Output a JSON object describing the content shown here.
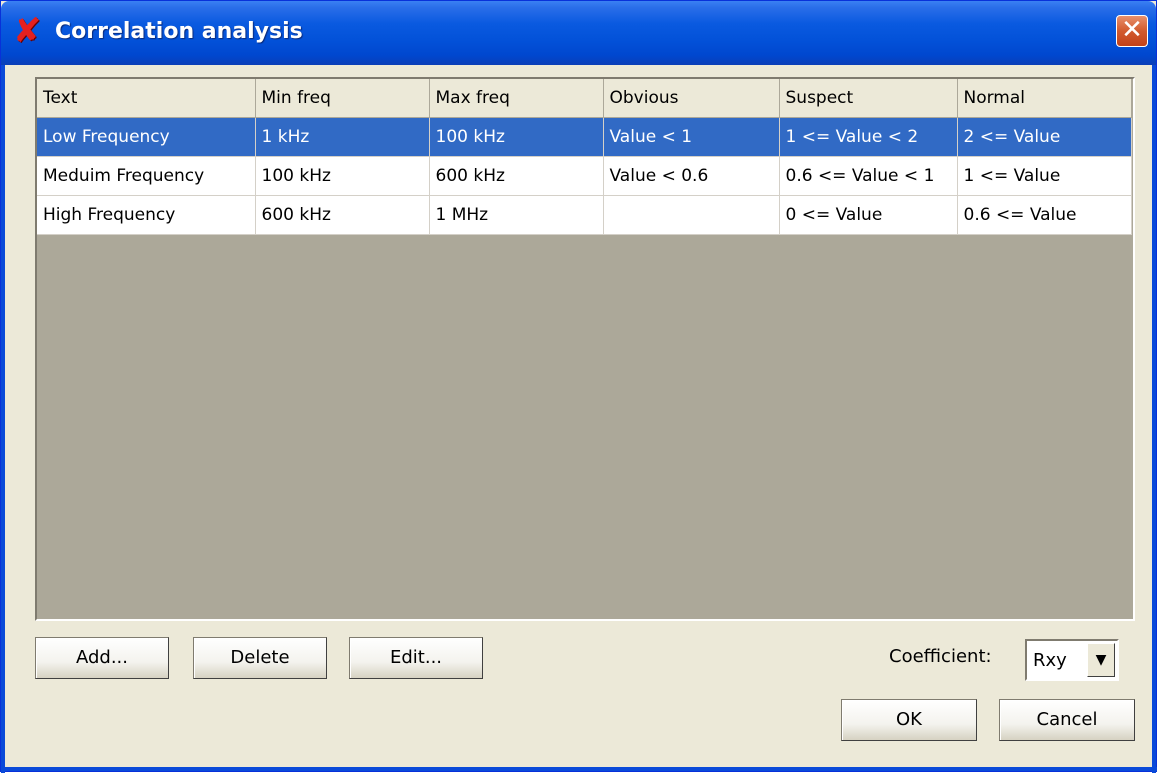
{
  "window": {
    "title": "Correlation analysis",
    "app_icon": "x-mark-icon",
    "close_icon": "close-icon",
    "close_label": "✕"
  },
  "table": {
    "columns": [
      "Text",
      "Min freq",
      "Max freq",
      "Obvious",
      "Suspect",
      "Normal"
    ],
    "rows": [
      {
        "selected": true,
        "cells": [
          "Low Frequency",
          "1 kHz",
          "100 kHz",
          "Value < 1",
          "1 <= Value < 2",
          "2 <= Value"
        ]
      },
      {
        "selected": false,
        "cells": [
          "Meduim Frequency",
          "100 kHz",
          "600 kHz",
          "Value < 0.6",
          "0.6 <= Value < 1",
          "1 <= Value"
        ]
      },
      {
        "selected": false,
        "cells": [
          "High Frequency",
          "600 kHz",
          "1 MHz",
          "",
          "0 <= Value",
          "0.6 <= Value"
        ]
      }
    ]
  },
  "buttons": {
    "add": "Add...",
    "delete": "Delete",
    "edit": "Edit...",
    "ok": "OK",
    "cancel": "Cancel"
  },
  "coefficient": {
    "label": "Coefficient:",
    "value": "Rxy",
    "arrow": "▼"
  },
  "colors": {
    "selection": "#316ac5",
    "titlebar": "#0352d9",
    "dialog_bg": "#ece9d8"
  }
}
